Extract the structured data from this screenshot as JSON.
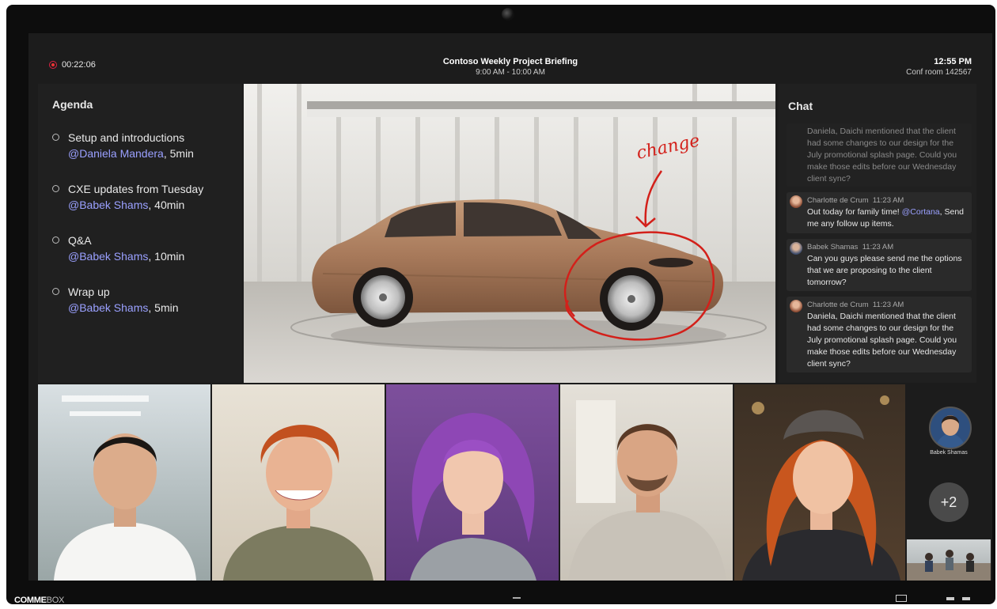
{
  "meeting": {
    "recording_time": "00:22:06",
    "title": "Contoso Weekly Project Briefing",
    "time_range": "9:00 AM - 10:00 AM",
    "clock": "12:55 PM",
    "room": "Conf room 142567"
  },
  "agenda": {
    "heading": "Agenda",
    "items": [
      {
        "title": "Setup and introductions",
        "mention": "@Daniela Mandera",
        "duration": ", 5min"
      },
      {
        "title": "CXE updates from Tuesday",
        "mention": "@Babek Shams",
        "duration": ", 40min"
      },
      {
        "title": "Q&A",
        "mention": "@Babek Shams",
        "duration": ", 10min"
      },
      {
        "title": "Wrap up",
        "mention": "@Babek Shams",
        "duration": ", 5min"
      }
    ]
  },
  "stage": {
    "annotation": "change"
  },
  "chat": {
    "heading": "Chat",
    "messages": [
      {
        "author": "",
        "time": "",
        "text": "Daniela, Daichi mentioned that the client had some changes to our design for the July promotional splash page. Could you make those edits before our Wednesday client sync?"
      },
      {
        "author": "Charlotte de Crum",
        "time": "11:23 AM",
        "text_before": "Out today for family time! ",
        "mention": "@Cortana",
        "text_after": ", Send me any follow up items."
      },
      {
        "author": "Babek Shamas",
        "time": "11:23 AM",
        "text": "Can you guys please send me the options that we are proposing to the client tomorrow?"
      },
      {
        "author": "Charlotte de Crum",
        "time": "11:23 AM",
        "text": "Daniela, Daichi mentioned that the client had some changes to our design for the July promotional splash page. Could you make those edits before our Wednesday client sync?"
      }
    ]
  },
  "participants": {
    "featured_name": "Babek Shamas",
    "overflow_count": "+2"
  },
  "device": {
    "brand_bold": "COMME",
    "brand_light": "BOX"
  },
  "colors": {
    "accent_mention": "#9aa0ff",
    "recording": "#e33333",
    "panel": "#202020",
    "background": "#1c1c1c"
  }
}
